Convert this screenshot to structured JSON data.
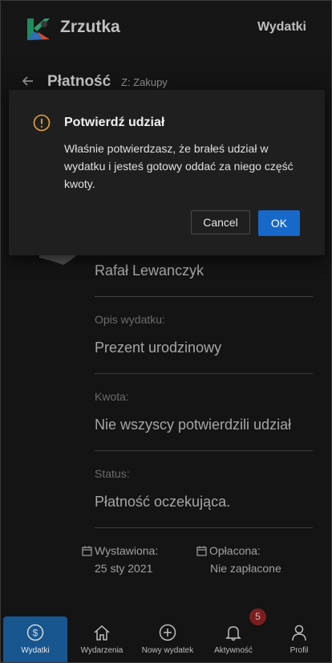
{
  "header": {
    "app_title": "Zrzutka",
    "link_label": "Wydatki"
  },
  "page": {
    "title": "Płatność",
    "subtitle": "Z: Zakupy"
  },
  "details": {
    "payer_name": "Rafał Lewanczyk",
    "description_label": "Opis wydatku:",
    "description_value": "Prezent urodzinowy",
    "amount_label": "Kwota:",
    "amount_value": "Nie wszyscy potwierdzili udział",
    "status_label": "Status:",
    "status_value": "Płatność oczekująca.",
    "issued_label": "Wystawiona:",
    "issued_value": "25 sty 2021",
    "paid_label": "Opłacona:",
    "paid_value": "Nie zapłacone"
  },
  "modal": {
    "title": "Potwierdź udział",
    "body": "Właśnie potwierdzasz, że brałeś udział w wydatku i jesteś gotowy oddać za niego część kwoty.",
    "cancel_label": "Cancel",
    "ok_label": "OK",
    "icon": "warning-circle-icon"
  },
  "nav": {
    "items": [
      {
        "label": "Wydatki",
        "icon": "dollar-circle-icon",
        "active": true
      },
      {
        "label": "Wydarzenia",
        "icon": "home-icon"
      },
      {
        "label": "Nowy wydatek",
        "icon": "plus-circle-icon"
      },
      {
        "label": "Aktywność",
        "icon": "bell-icon"
      },
      {
        "label": "Profil",
        "icon": "user-icon"
      }
    ],
    "activity_badge": "5"
  },
  "colors": {
    "accent": "#1668c9",
    "nav_active": "#17568f",
    "warning": "#e8a33a",
    "badge": "#7a1f1f"
  }
}
